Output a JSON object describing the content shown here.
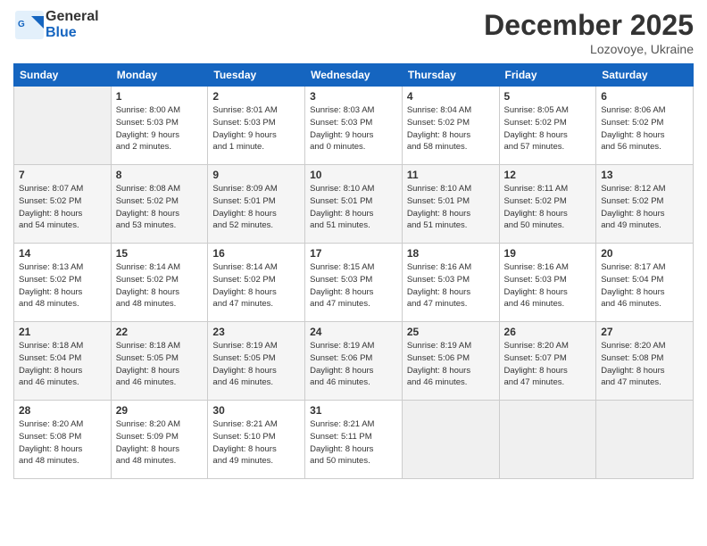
{
  "header": {
    "logo_line1": "General",
    "logo_line2": "Blue",
    "month": "December 2025",
    "location": "Lozovoye, Ukraine"
  },
  "days_of_week": [
    "Sunday",
    "Monday",
    "Tuesday",
    "Wednesday",
    "Thursday",
    "Friday",
    "Saturday"
  ],
  "weeks": [
    [
      {
        "day": "",
        "info": ""
      },
      {
        "day": "1",
        "info": "Sunrise: 8:00 AM\nSunset: 5:03 PM\nDaylight: 9 hours\nand 2 minutes."
      },
      {
        "day": "2",
        "info": "Sunrise: 8:01 AM\nSunset: 5:03 PM\nDaylight: 9 hours\nand 1 minute."
      },
      {
        "day": "3",
        "info": "Sunrise: 8:03 AM\nSunset: 5:03 PM\nDaylight: 9 hours\nand 0 minutes."
      },
      {
        "day": "4",
        "info": "Sunrise: 8:04 AM\nSunset: 5:02 PM\nDaylight: 8 hours\nand 58 minutes."
      },
      {
        "day": "5",
        "info": "Sunrise: 8:05 AM\nSunset: 5:02 PM\nDaylight: 8 hours\nand 57 minutes."
      },
      {
        "day": "6",
        "info": "Sunrise: 8:06 AM\nSunset: 5:02 PM\nDaylight: 8 hours\nand 56 minutes."
      }
    ],
    [
      {
        "day": "7",
        "info": "Sunrise: 8:07 AM\nSunset: 5:02 PM\nDaylight: 8 hours\nand 54 minutes."
      },
      {
        "day": "8",
        "info": "Sunrise: 8:08 AM\nSunset: 5:02 PM\nDaylight: 8 hours\nand 53 minutes."
      },
      {
        "day": "9",
        "info": "Sunrise: 8:09 AM\nSunset: 5:01 PM\nDaylight: 8 hours\nand 52 minutes."
      },
      {
        "day": "10",
        "info": "Sunrise: 8:10 AM\nSunset: 5:01 PM\nDaylight: 8 hours\nand 51 minutes."
      },
      {
        "day": "11",
        "info": "Sunrise: 8:10 AM\nSunset: 5:01 PM\nDaylight: 8 hours\nand 51 minutes."
      },
      {
        "day": "12",
        "info": "Sunrise: 8:11 AM\nSunset: 5:02 PM\nDaylight: 8 hours\nand 50 minutes."
      },
      {
        "day": "13",
        "info": "Sunrise: 8:12 AM\nSunset: 5:02 PM\nDaylight: 8 hours\nand 49 minutes."
      }
    ],
    [
      {
        "day": "14",
        "info": "Sunrise: 8:13 AM\nSunset: 5:02 PM\nDaylight: 8 hours\nand 48 minutes."
      },
      {
        "day": "15",
        "info": "Sunrise: 8:14 AM\nSunset: 5:02 PM\nDaylight: 8 hours\nand 48 minutes."
      },
      {
        "day": "16",
        "info": "Sunrise: 8:14 AM\nSunset: 5:02 PM\nDaylight: 8 hours\nand 47 minutes."
      },
      {
        "day": "17",
        "info": "Sunrise: 8:15 AM\nSunset: 5:03 PM\nDaylight: 8 hours\nand 47 minutes."
      },
      {
        "day": "18",
        "info": "Sunrise: 8:16 AM\nSunset: 5:03 PM\nDaylight: 8 hours\nand 47 minutes."
      },
      {
        "day": "19",
        "info": "Sunrise: 8:16 AM\nSunset: 5:03 PM\nDaylight: 8 hours\nand 46 minutes."
      },
      {
        "day": "20",
        "info": "Sunrise: 8:17 AM\nSunset: 5:04 PM\nDaylight: 8 hours\nand 46 minutes."
      }
    ],
    [
      {
        "day": "21",
        "info": "Sunrise: 8:18 AM\nSunset: 5:04 PM\nDaylight: 8 hours\nand 46 minutes."
      },
      {
        "day": "22",
        "info": "Sunrise: 8:18 AM\nSunset: 5:05 PM\nDaylight: 8 hours\nand 46 minutes."
      },
      {
        "day": "23",
        "info": "Sunrise: 8:19 AM\nSunset: 5:05 PM\nDaylight: 8 hours\nand 46 minutes."
      },
      {
        "day": "24",
        "info": "Sunrise: 8:19 AM\nSunset: 5:06 PM\nDaylight: 8 hours\nand 46 minutes."
      },
      {
        "day": "25",
        "info": "Sunrise: 8:19 AM\nSunset: 5:06 PM\nDaylight: 8 hours\nand 46 minutes."
      },
      {
        "day": "26",
        "info": "Sunrise: 8:20 AM\nSunset: 5:07 PM\nDaylight: 8 hours\nand 47 minutes."
      },
      {
        "day": "27",
        "info": "Sunrise: 8:20 AM\nSunset: 5:08 PM\nDaylight: 8 hours\nand 47 minutes."
      }
    ],
    [
      {
        "day": "28",
        "info": "Sunrise: 8:20 AM\nSunset: 5:08 PM\nDaylight: 8 hours\nand 48 minutes."
      },
      {
        "day": "29",
        "info": "Sunrise: 8:20 AM\nSunset: 5:09 PM\nDaylight: 8 hours\nand 48 minutes."
      },
      {
        "day": "30",
        "info": "Sunrise: 8:21 AM\nSunset: 5:10 PM\nDaylight: 8 hours\nand 49 minutes."
      },
      {
        "day": "31",
        "info": "Sunrise: 8:21 AM\nSunset: 5:11 PM\nDaylight: 8 hours\nand 50 minutes."
      },
      {
        "day": "",
        "info": ""
      },
      {
        "day": "",
        "info": ""
      },
      {
        "day": "",
        "info": ""
      }
    ]
  ]
}
